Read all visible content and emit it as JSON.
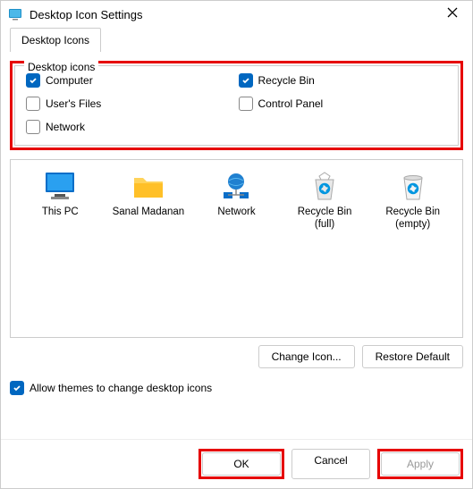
{
  "window": {
    "title": "Desktop Icon Settings",
    "close_tooltip": "Close"
  },
  "tabs": {
    "desktop_icons": "Desktop Icons"
  },
  "group": {
    "legend": "Desktop icons",
    "computer": "Computer",
    "recycle_bin": "Recycle Bin",
    "users_files": "User's Files",
    "control_panel": "Control Panel",
    "network": "Network"
  },
  "checked": {
    "computer": true,
    "recycle_bin": true,
    "users_files": false,
    "control_panel": false,
    "network": false,
    "allow_themes": true
  },
  "preview": {
    "this_pc": "This PC",
    "user_folder": "Sanal Madanan",
    "network": "Network",
    "recycle_full": "Recycle Bin (full)",
    "recycle_empty": "Recycle Bin (empty)"
  },
  "buttons": {
    "change_icon": "Change Icon...",
    "restore_default": "Restore Default",
    "ok": "OK",
    "cancel": "Cancel",
    "apply": "Apply"
  },
  "allow_themes_label": "Allow themes to change desktop icons"
}
